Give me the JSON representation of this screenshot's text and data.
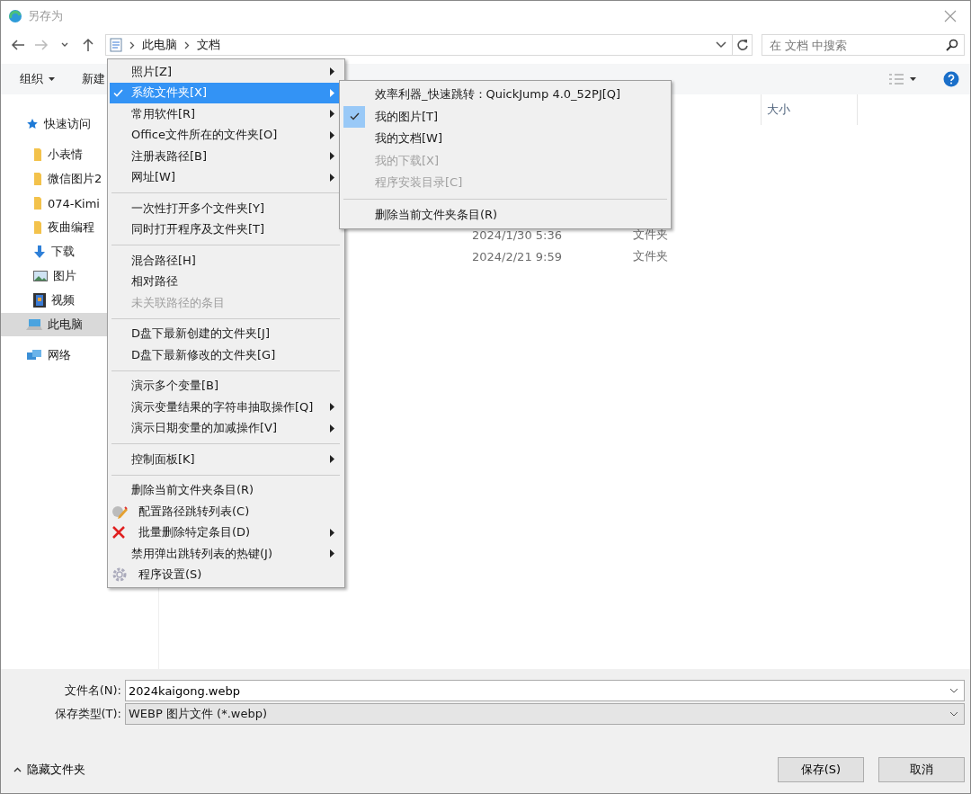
{
  "window": {
    "title": "另存为"
  },
  "address": {
    "path": [
      "此电脑",
      "文档"
    ],
    "search_placeholder": "在 文档 中搜索"
  },
  "toolbar": {
    "organize": "组织",
    "new": "新建"
  },
  "sidebar": {
    "items": [
      {
        "label": "快速访问",
        "kind": "star",
        "selected": false,
        "children": [
          {
            "label": "小表情",
            "kind": "folder",
            "selected": false
          },
          {
            "label": "微信图片2",
            "kind": "folder",
            "selected": false
          },
          {
            "label": "074-Kimi",
            "kind": "folder",
            "selected": false
          },
          {
            "label": "夜曲编程",
            "kind": "folder",
            "selected": false
          },
          {
            "label": "下载",
            "kind": "download",
            "selected": false
          },
          {
            "label": "图片",
            "kind": "pictures",
            "selected": false
          },
          {
            "label": "视频",
            "kind": "video",
            "selected": false
          }
        ]
      },
      {
        "label": "此电脑",
        "kind": "computer",
        "selected": true
      },
      {
        "label": "网络",
        "kind": "network",
        "selected": false
      }
    ]
  },
  "file_list": {
    "column_size": "大小",
    "rows": [
      {
        "date": "2024/1/30 5:36",
        "type": "文件夹"
      },
      {
        "date": "2024/2/21 9:59",
        "type": "文件夹"
      }
    ]
  },
  "menu": {
    "items": [
      {
        "kind": "plain",
        "label": "照片[Z]",
        "submenu": true,
        "selected": false,
        "checked": false,
        "disabled": false
      },
      {
        "kind": "plain",
        "label": "系统文件夹[X]",
        "submenu": true,
        "selected": true,
        "checked": true,
        "disabled": false
      },
      {
        "kind": "plain",
        "label": "常用软件[R]",
        "submenu": true,
        "selected": false,
        "checked": false,
        "disabled": false
      },
      {
        "kind": "plain",
        "label": "Office文件所在的文件夹[O]",
        "submenu": true,
        "selected": false,
        "checked": false,
        "disabled": false
      },
      {
        "kind": "plain",
        "label": "注册表路径[B]",
        "submenu": true,
        "selected": false,
        "checked": false,
        "disabled": false
      },
      {
        "kind": "plain",
        "label": "网址[W]",
        "submenu": true,
        "selected": false,
        "checked": false,
        "disabled": false
      },
      {
        "kind": "separator"
      },
      {
        "kind": "plain",
        "label": "一次性打开多个文件夹[Y]",
        "submenu": false,
        "selected": false,
        "checked": false,
        "disabled": false
      },
      {
        "kind": "plain",
        "label": "同时打开程序及文件夹[T]",
        "submenu": false,
        "selected": false,
        "checked": false,
        "disabled": false
      },
      {
        "kind": "separator"
      },
      {
        "kind": "plain",
        "label": "混合路径[H]",
        "submenu": false,
        "selected": false,
        "checked": false,
        "disabled": false
      },
      {
        "kind": "plain",
        "label": "相对路径",
        "submenu": false,
        "selected": false,
        "checked": false,
        "disabled": false
      },
      {
        "kind": "plain",
        "label": "未关联路径的条目",
        "submenu": false,
        "selected": false,
        "checked": false,
        "disabled": true
      },
      {
        "kind": "separator"
      },
      {
        "kind": "plain",
        "label": "D盘下最新创建的文件夹[J]",
        "submenu": false,
        "selected": false,
        "checked": false,
        "disabled": false
      },
      {
        "kind": "plain",
        "label": "D盘下最新修改的文件夹[G]",
        "submenu": false,
        "selected": false,
        "checked": false,
        "disabled": false
      },
      {
        "kind": "separator"
      },
      {
        "kind": "plain",
        "label": "演示多个变量[B]",
        "submenu": false,
        "selected": false,
        "checked": false,
        "disabled": false
      },
      {
        "kind": "plain",
        "label": "演示变量结果的字符串抽取操作[Q]",
        "submenu": true,
        "selected": false,
        "checked": false,
        "disabled": false
      },
      {
        "kind": "plain",
        "label": "演示日期变量的加减操作[V]",
        "submenu": true,
        "selected": false,
        "checked": false,
        "disabled": false
      },
      {
        "kind": "separator"
      },
      {
        "kind": "plain",
        "label": "控制面板[K]",
        "submenu": true,
        "selected": false,
        "checked": false,
        "disabled": false
      },
      {
        "kind": "separator"
      },
      {
        "kind": "plain",
        "label": "删除当前文件夹条目(R)",
        "submenu": false,
        "selected": false,
        "checked": false,
        "disabled": false
      },
      {
        "kind": "pencil",
        "label": "配置路径跳转列表(C)",
        "submenu": false,
        "selected": false,
        "checked": false,
        "disabled": false
      },
      {
        "kind": "cross",
        "label": "批量删除特定条目(D)",
        "submenu": true,
        "selected": false,
        "checked": false,
        "disabled": false
      },
      {
        "kind": "plain",
        "label": "禁用弹出跳转列表的热键(J)",
        "submenu": true,
        "selected": false,
        "checked": false,
        "disabled": false
      },
      {
        "kind": "gear",
        "label": "程序设置(S)",
        "submenu": false,
        "selected": false,
        "checked": false,
        "disabled": false
      }
    ]
  },
  "submenu": {
    "items": [
      {
        "kind": "plain",
        "label": "效率利器_快速跳转：QuickJump 4.0_52PJ[Q]",
        "checked": false,
        "disabled": false
      },
      {
        "kind": "plain",
        "label": "我的图片[T]",
        "checked": true,
        "disabled": false
      },
      {
        "kind": "plain",
        "label": "我的文档[W]",
        "checked": false,
        "disabled": false
      },
      {
        "kind": "plain",
        "label": "我的下载[X]",
        "checked": false,
        "disabled": true
      },
      {
        "kind": "plain",
        "label": "程序安装目录[C]",
        "checked": false,
        "disabled": true
      },
      {
        "kind": "separator"
      },
      {
        "kind": "plain",
        "label": "删除当前文件夹条目(R)",
        "checked": false,
        "disabled": false
      }
    ]
  },
  "footer": {
    "filename_label": "文件名(N):",
    "filename": "2024kaigong.webp",
    "type_label": "保存类型(T):",
    "type": "WEBP 图片文件 (*.webp)",
    "hide_folders": "隐藏文件夹",
    "save": "保存(S)",
    "cancel": "取消"
  }
}
